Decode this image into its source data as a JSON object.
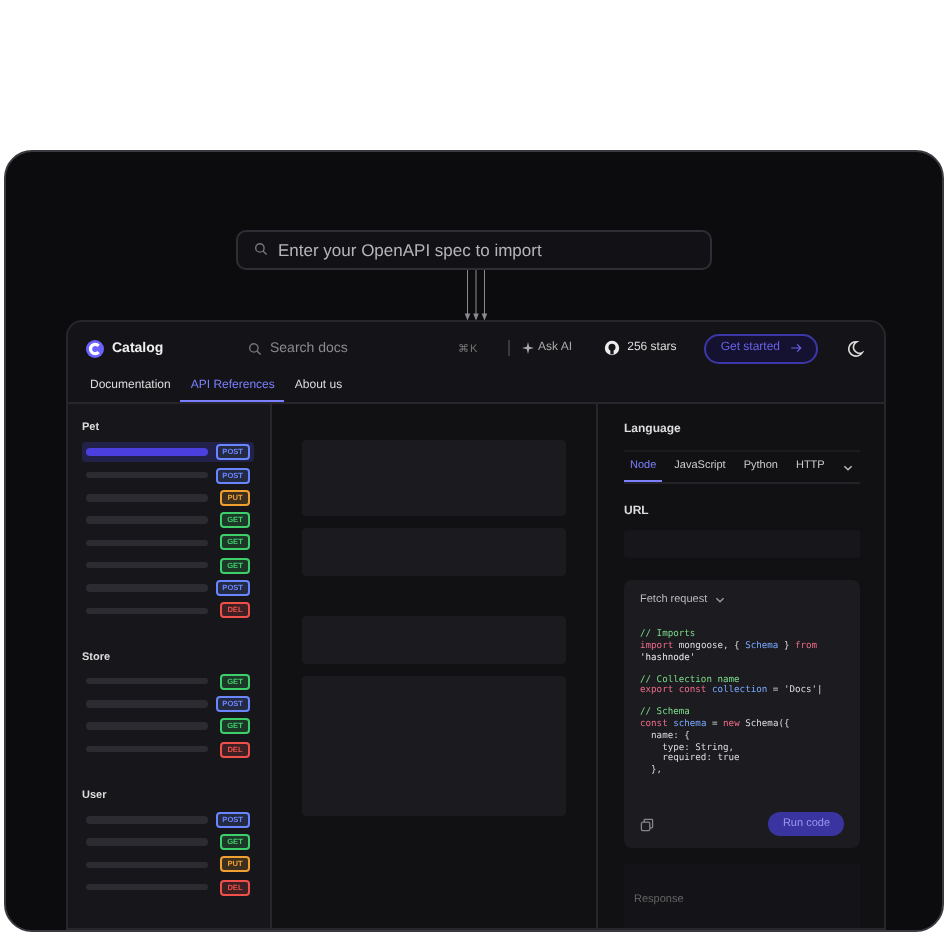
{
  "import_field": {
    "placeholder": "Enter your OpenAPI spec to import"
  },
  "app": {
    "logo": "Catalog",
    "search": {
      "placeholder": "Search docs",
      "shortcut": "⌘K"
    },
    "ask_ai": "Ask AI",
    "github_stars": "256 stars",
    "get_started": "Get started",
    "tabs": [
      {
        "label": "Documentation",
        "selected": false
      },
      {
        "label": "API References",
        "selected": true
      },
      {
        "label": "About us",
        "selected": false
      }
    ],
    "sidebar": [
      {
        "title": "Pet",
        "items": [
          {
            "method": "POST",
            "color": "#6a86ff",
            "selected": true
          },
          {
            "method": "POST",
            "color": "#6a86ff",
            "selected": false
          },
          {
            "method": "PUT",
            "color": "#f0a030",
            "selected": false
          },
          {
            "method": "GET",
            "color": "#3ecf6a",
            "selected": false
          },
          {
            "method": "GET",
            "color": "#3ecf6a",
            "selected": false
          },
          {
            "method": "GET",
            "color": "#3ecf6a",
            "selected": false
          },
          {
            "method": "POST",
            "color": "#6a86ff",
            "selected": false
          },
          {
            "method": "DEL",
            "color": "#f0504a",
            "selected": false
          }
        ]
      },
      {
        "title": "Store",
        "items": [
          {
            "method": "GET",
            "color": "#3ecf6a",
            "selected": false
          },
          {
            "method": "POST",
            "color": "#6a86ff",
            "selected": false
          },
          {
            "method": "GET",
            "color": "#3ecf6a",
            "selected": false
          },
          {
            "method": "DEL",
            "color": "#f0504a",
            "selected": false
          }
        ]
      },
      {
        "title": "User",
        "items": [
          {
            "method": "POST",
            "color": "#6a86ff",
            "selected": false
          },
          {
            "method": "GET",
            "color": "#3ecf6a",
            "selected": false
          },
          {
            "method": "PUT",
            "color": "#f0a030",
            "selected": false
          },
          {
            "method": "DEL",
            "color": "#f0504a",
            "selected": false
          }
        ]
      }
    ],
    "panel": {
      "language_label": "Language",
      "languages": [
        {
          "label": "Node",
          "selected": true
        },
        {
          "label": "JavaScript",
          "selected": false
        },
        {
          "label": "Python",
          "selected": false
        },
        {
          "label": "HTTP",
          "selected": false
        }
      ],
      "url_label": "URL",
      "code": {
        "title": "Fetch request",
        "blocks": [
          [
            {
              "tokens": [
                {
                  "kind": "comment",
                  "text": "// Imports"
                }
              ]
            },
            {
              "tokens": [
                {
                  "kind": "keyword",
                  "text": "import"
                },
                {
                  "kind": "plain",
                  "text": " mongoose, { "
                },
                {
                  "kind": "ident",
                  "text": "Schema"
                },
                {
                  "kind": "plain",
                  "text": " } "
                },
                {
                  "kind": "keyword",
                  "text": "from"
                }
              ]
            },
            {
              "tokens": [
                {
                  "kind": "string",
                  "text": "'hashnode'"
                }
              ]
            }
          ],
          [
            {
              "tokens": [
                {
                  "kind": "comment",
                  "text": "// Collection name"
                }
              ]
            },
            {
              "tokens": [
                {
                  "kind": "keyword",
                  "text": "export const "
                },
                {
                  "kind": "ident",
                  "text": "collection"
                },
                {
                  "kind": "plain",
                  "text": " = 'Docs'|"
                }
              ]
            }
          ],
          [
            {
              "tokens": [
                {
                  "kind": "comment",
                  "text": "// Schema"
                }
              ]
            },
            {
              "tokens": [
                {
                  "kind": "keyword",
                  "text": "const "
                },
                {
                  "kind": "ident",
                  "text": "schema"
                },
                {
                  "kind": "plain",
                  "text": " = "
                },
                {
                  "kind": "keyword",
                  "text": "new"
                },
                {
                  "kind": "plain",
                  "text": " Schema({"
                }
              ]
            },
            {
              "tokens": [
                {
                  "kind": "plain",
                  "text": "  name: {"
                }
              ]
            },
            {
              "tokens": [
                {
                  "kind": "plain",
                  "text": "    type: String,"
                }
              ]
            },
            {
              "tokens": [
                {
                  "kind": "plain",
                  "text": "    required: true"
                }
              ]
            },
            {
              "tokens": [
                {
                  "kind": "plain",
                  "text": "  },"
                }
              ]
            }
          ]
        ],
        "run_label": "Run code"
      },
      "response_label": "Response"
    }
  }
}
